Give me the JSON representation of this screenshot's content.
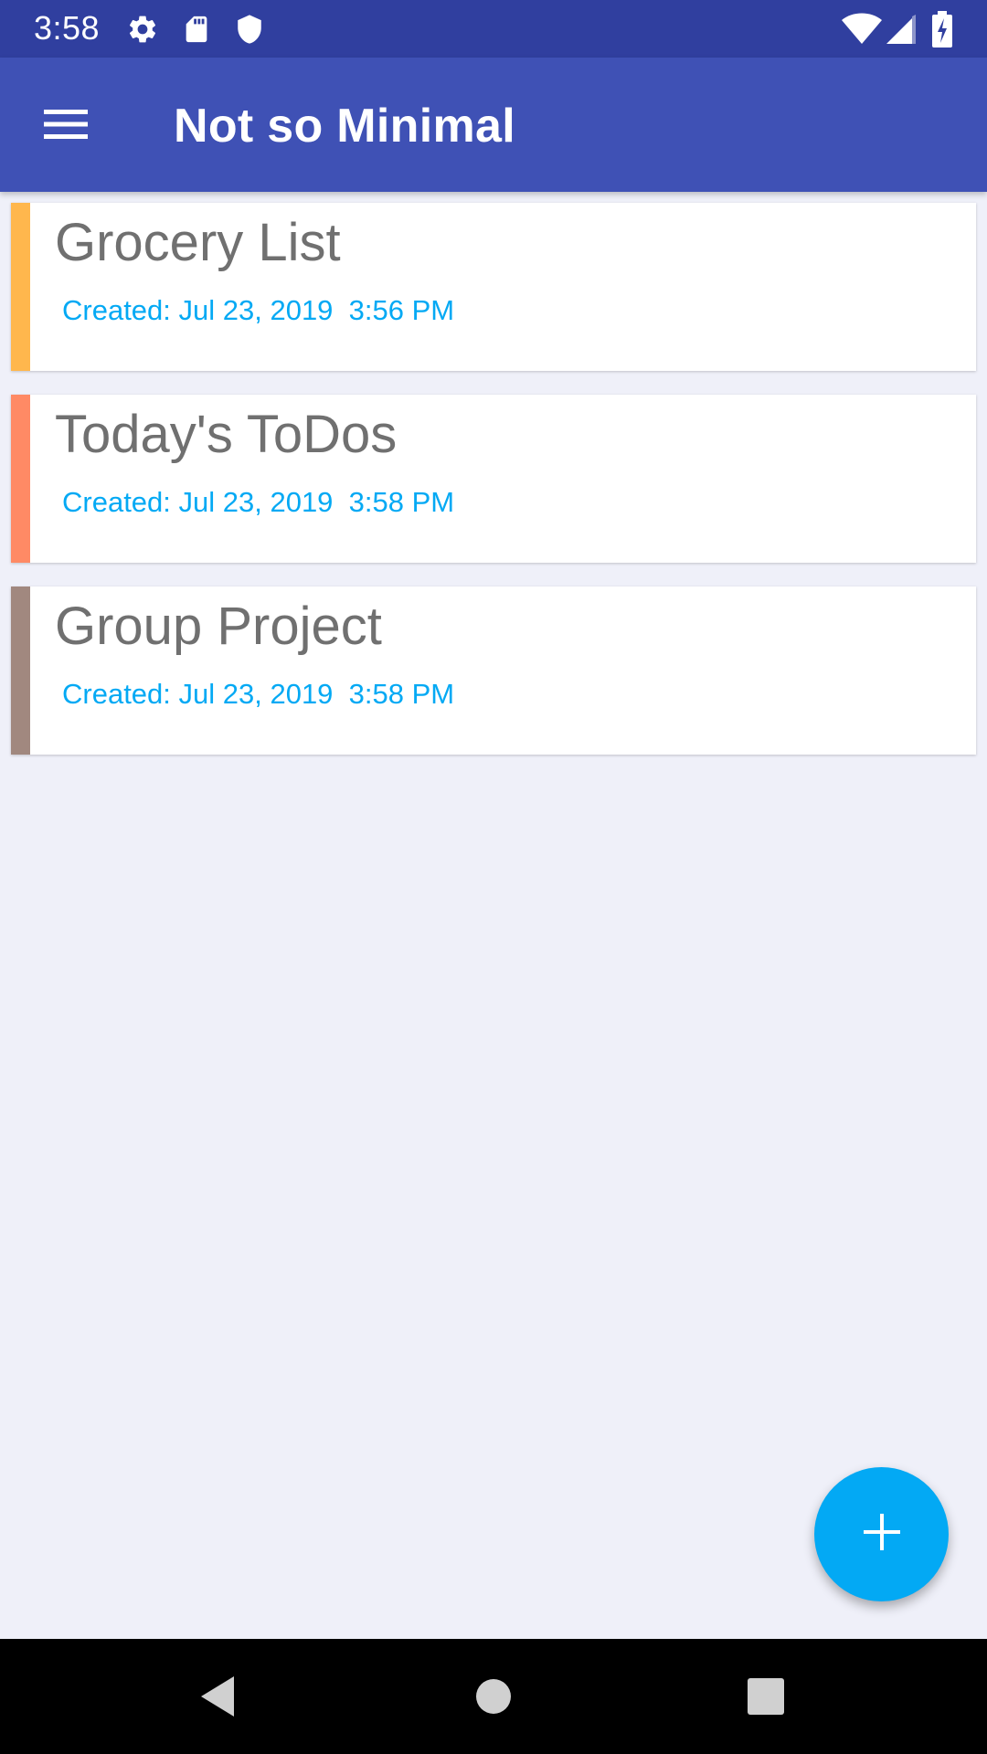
{
  "status_bar": {
    "time": "3:58",
    "icons": [
      "gear-icon",
      "sd-card-icon",
      "shield-icon",
      "wifi-icon",
      "cell-signal-icon",
      "battery-charging-icon"
    ]
  },
  "app_bar": {
    "title": "Not so Minimal",
    "menu_icon": "hamburger-menu-icon",
    "color": "#3f51b5"
  },
  "notes": [
    {
      "title": "Grocery List",
      "created": "Created: Jul 23, 2019  3:56 PM",
      "color": "#ffb74d"
    },
    {
      "title": "Today's ToDos",
      "created": "Created: Jul 23, 2019  3:58 PM",
      "color": "#ff8a65"
    },
    {
      "title": "Group Project",
      "created": "Created: Jul 23, 2019  3:58 PM",
      "color": "#a1887f"
    }
  ],
  "fab": {
    "icon": "plus-icon",
    "color": "#03a9f4"
  },
  "nav_bar": {
    "icons": [
      "back-icon",
      "home-icon",
      "recents-icon"
    ]
  }
}
